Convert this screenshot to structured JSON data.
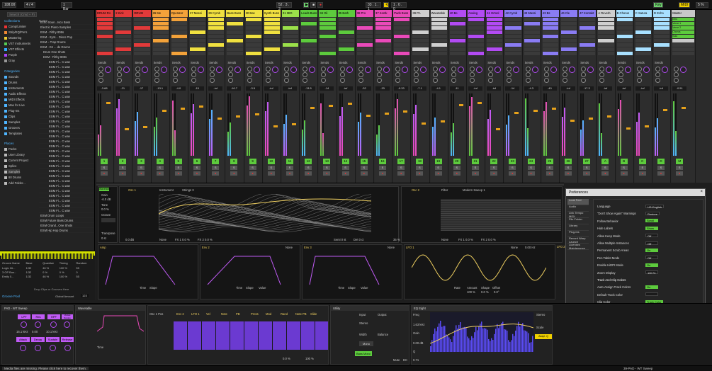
{
  "colors": {
    "accent": "#f0d000",
    "green": "#5dcb3d",
    "purple": "#b24bf3",
    "blue": "#4fb5ff"
  },
  "transport": {
    "tempo": "108.00",
    "sig": "4 / 4",
    "bar": "1 Bar",
    "pos": "52 . 3 . 3",
    "loop_start": "33 . 1 . 1",
    "loop_len": "1 . 0 . 0",
    "key": "Key",
    "midi": "MIDI",
    "cpu": "5 %"
  },
  "browser": {
    "search_placeholder": "Search (Cmd + F)",
    "collections_title": "Collections",
    "collections": [
      {
        "label": "Comp/Limiter",
        "color": "#e33"
      },
      {
        "label": "Strip/EQ/Pre's",
        "color": "#e83"
      },
      {
        "label": "Mastering",
        "color": "#ec3"
      },
      {
        "label": "VST Instruments",
        "color": "#5c5"
      },
      {
        "label": "VST Effects",
        "color": "#3af"
      },
      {
        "label": "Purple",
        "color": "#a4f"
      },
      {
        "label": "Gray",
        "color": "#999"
      }
    ],
    "categories_title": "Categories",
    "categories": [
      "Sounds",
      "Drums",
      "Instruments",
      "Audio Effects",
      "MIDI Effects",
      "Max for Live",
      "Plug-Ins",
      "Clips",
      "Samples",
      "Grooves",
      "Templates"
    ],
    "places_title": "Places",
    "places": [
      "Packs",
      "User Library",
      "Current Project",
      "Splice",
      "Samples",
      "80 Drums",
      "Add Folder..."
    ],
    "list_header": "Name",
    "list": [
      "Echo Soun...Isco Bass",
      "Electric Piano Samples",
      "ESM - Filthy 808s",
      "ESM - Synt... Disco Pop",
      "ESM – Trap Drums",
      "ESM - DJ ... de Drums",
      "Drum One Shots",
      "ESM - Filthy 808s",
      "ESM Fi... C.wav",
      "ESM Fi... C.wav",
      "ESM Fi... C.wav",
      "ESM Fi... C.wav",
      "ESM Fi... C.wav",
      "ESM Fi... C.wav",
      "ESM Fi... C.wav",
      "ESM Fi... C.wav",
      "ESM Fi... C.wav",
      "ESM Fi... C.wav",
      "ESM Fi... C.wav",
      "ESM Fi... C.wav",
      "ESM Fi... C.wav",
      "ESM Fi... C.wav",
      "ESM Fi... C.wav",
      "ESM Fi... C.wav",
      "ESM Fi... C.wav",
      "ESM Fi... C.wav",
      "ESM Fi... C.wav",
      "ESM Fi... C.wav",
      "ESM Fi... C.wav",
      "ESM Fi... C.wav",
      "ESM Fi... C.wav",
      "ESM Fi... C.wav",
      "ESM Fi... C.wav",
      "ESM Fi... C.wav",
      "ESM Fi... C.wav",
      "ESM Fi... C.wav",
      "ESM Fi... C.wav",
      "ESM Fi... C.wav",
      "ESM Fi... C.wav",
      "ESM Drum Loops",
      "ESM Future Bass Drums",
      "ESM Grand...One Shots",
      "ESM Hip Hop Drums"
    ]
  },
  "groove": {
    "headers": [
      "Groove Name",
      "Base",
      "Quantize",
      "Timing",
      "Random"
    ],
    "rows": [
      [
        "Logic 16...",
        "1/32",
        "46 %",
        "100 %",
        "55"
      ],
      [
        "3 OP Bus...",
        "1/32",
        "0 %",
        "0 %",
        "0"
      ],
      [
        "Emily 0...",
        "1/32",
        "46 %",
        "100 %",
        "55"
      ]
    ],
    "hint": "Drop Clips or Grooves Here",
    "amount_label": "Global Amount",
    "amount": "123",
    "pool": "Groove Pool"
  },
  "tracks": [
    {
      "name": "DRUM RA",
      "color": "#e23a3a",
      "vol": "-3.68",
      "num": "1"
    },
    {
      "name": "2 Kick",
      "color": "#e23a3a",
      "vol": "-21",
      "num": "2"
    },
    {
      "name": "DRUM",
      "color": "#e23a3a",
      "vol": "-17",
      "num": "3"
    },
    {
      "name": "26 Me",
      "color": "#f3a23a",
      "vol": "-13.1",
      "num": "4"
    },
    {
      "name": "Operator",
      "color": "#f3a23a",
      "vol": "-4.0",
      "num": "5"
    },
    {
      "name": "27 Massi",
      "color": "#f0e040",
      "vol": "-15",
      "num": "6"
    },
    {
      "name": "29 Cymb",
      "color": "#f0e040",
      "vol": "-inf",
      "num": "7"
    },
    {
      "name": "Bass Buss",
      "color": "#f0e040",
      "vol": "-16.7",
      "num": "8"
    },
    {
      "name": "30 Bas",
      "color": "#f0e040",
      "vol": "-3.5",
      "num": "9"
    },
    {
      "name": "Synth Buss",
      "color": "#f0e040",
      "vol": "-inf",
      "num": "10"
    },
    {
      "name": "31 MID",
      "color": "#9be04a",
      "vol": "-inf",
      "num": "11"
    },
    {
      "name": "Leads Buss",
      "color": "#5dcb3d",
      "vol": "-13.5",
      "num": "12"
    },
    {
      "name": "34 Gli",
      "color": "#5dcb3d",
      "vol": "-14",
      "num": "13"
    },
    {
      "name": "35 Bath",
      "color": "#5dcb3d",
      "vol": "-inf",
      "num": "14"
    },
    {
      "name": "38 Pro",
      "color": "#e94ab9",
      "vol": "-32",
      "num": "15"
    },
    {
      "name": "37 Kontk",
      "color": "#e94ab9",
      "vol": "-33",
      "num": "16"
    },
    {
      "name": "Pads Buss",
      "color": "#e94ab9",
      "vol": "-9.33",
      "num": "17"
    },
    {
      "name": "39 PA",
      "color": "#cfcfcf",
      "vol": "-7.1",
      "num": "18"
    },
    {
      "name": "Wavetable",
      "color": "#cfcfcf",
      "vol": "-4.1",
      "num": "19"
    },
    {
      "name": "40 Be",
      "color": "#b24bf3",
      "vol": "-11",
      "num": "20"
    },
    {
      "name": "Analog",
      "color": "#b24bf3",
      "vol": "-inf",
      "num": "21"
    },
    {
      "name": "41 Grtool",
      "color": "#b24bf3",
      "vol": "-inf",
      "num": "22"
    },
    {
      "name": "42 Cymb",
      "color": "#8a7cf3",
      "vol": "-14",
      "num": "23"
    },
    {
      "name": "43 Massi",
      "color": "#8a7cf3",
      "vol": "-4.3",
      "num": "24"
    },
    {
      "name": "43 Bs",
      "color": "#8a7cf3",
      "vol": "-40",
      "num": "25"
    },
    {
      "name": "46 Cle",
      "color": "#8a7cf3",
      "vol": "-inf",
      "num": "26"
    },
    {
      "name": "47 Kontakt",
      "color": "#8a7cf3",
      "vol": "-17.3",
      "num": "27"
    },
    {
      "name": "A Reverb",
      "color": "#cfcfcf",
      "vol": "-inf",
      "num": "A"
    },
    {
      "name": "B Chorus",
      "color": "#a8e0ff",
      "vol": "-inf",
      "num": "B"
    },
    {
      "name": "C Satura",
      "color": "#a8e0ff",
      "vol": "-inf",
      "num": "C"
    },
    {
      "name": "D Echo",
      "color": "#a8e0ff",
      "vol": "-inf",
      "num": "D"
    },
    {
      "name": "Master",
      "color": "#c8c8c8",
      "vol": "-0.51",
      "num": "M"
    }
  ],
  "master_clips": [
    "Intro",
    "Verse 1",
    "Verse 2",
    "Chorus",
    "Solo"
  ],
  "mixer": {
    "sends_label": "Sends"
  },
  "wavetable": {
    "title": "Wavetable",
    "osc1": "Osc 1",
    "osc2": "Osc 2",
    "inst": "Instrument",
    "inst_val": "Strings 3",
    "filter": "Filter",
    "filter_val": "Modern Sweep 1",
    "gain": "Gain",
    "gain_val": "-6.0 dB",
    "tone": "Tone",
    "tone_val": "0.0 %",
    "octave": "Octave",
    "transpose": "Transpose",
    "transpose_val": "0 st",
    "none": "None",
    "fx1": "FX 1 0.0 %",
    "fx2": "FX 2 0.0 %",
    "semi": "Semi 0 st",
    "det": "Det 0 ct",
    "pct": "35 %",
    "db": "0.0 dB",
    "amp": "Amp",
    "env2": "Env 2",
    "env3": "Env 3",
    "lfo1": "LFO 1",
    "lfo2": "LFO 2",
    "time": "Time",
    "slope": "Slope",
    "value": "Value",
    "rate": "Rate",
    "amount": "Amount",
    "shape": "Shape",
    "offset": "Offset",
    "rate_val": "0.00 Hz",
    "amount_val": "100 %",
    "shape_val": "0.0 %",
    "offset_val": "0.0°"
  },
  "preferences": {
    "title": "Preferences",
    "tabs": [
      "Look Feel",
      "Audio",
      "Link Tempo MIDI",
      "File Folder",
      "Library",
      "Plug-Ins",
      "Record Warp Launch",
      "Licenses Maintenance"
    ],
    "rows": [
      {
        "label": "Language",
        "value": "US-English",
        "style": "pd"
      },
      {
        "label": "\"Don't Show Again\" Warnings",
        "value": "Restore",
        "style": "pd"
      },
      {
        "label": "Follow Behavior",
        "value": "Scroll",
        "style": "pg"
      },
      {
        "label": "Hide Labels",
        "value": "Show",
        "style": "pg"
      },
      {
        "label": "Allow Keep Mode",
        "value": "Off",
        "style": "pd"
      },
      {
        "label": "Allow Multiple Instances",
        "value": "Off",
        "style": "pd"
      },
      {
        "label": "Permanent Scrub Areas",
        "value": "On",
        "style": "pg"
      },
      {
        "label": "Pen Tablet Mode",
        "value": "Off",
        "style": "pd"
      },
      {
        "label": "Enable HiDPI Mode",
        "value": "On",
        "style": "pg"
      },
      {
        "label": "Zoom Display",
        "value": "100 %",
        "style": "pd"
      },
      {
        "label": "Track And Clip Colors",
        "value": "",
        "style": "none"
      },
      {
        "label": "Auto-Assign Track Colors",
        "value": "On",
        "style": "pg"
      },
      {
        "label": "Default Track Color",
        "value": "",
        "style": "pd"
      },
      {
        "label": "Clip Color",
        "value": "Track Color",
        "style": "pg"
      },
      {
        "label": "Reduced Automatic Colors",
        "value": "Off",
        "style": "pd"
      },
      {
        "label": "Customization",
        "value": "",
        "style": "none"
      },
      {
        "label": "Theme",
        "value": "Purple Beige 2.0",
        "style": "pd"
      },
      {
        "label": "Brightness",
        "value": "85 %",
        "style": "pd"
      },
      {
        "label": "Color Intensity",
        "value": "0 %",
        "style": "pd"
      },
      {
        "label": "Color Hue",
        "value": "0 °",
        "style": "pd"
      },
      {
        "label": "Grid Line Intensity",
        "value": "88 %",
        "style": "pd"
      }
    ]
  },
  "bottom": {
    "pad_title": "PAD - WT Sweep",
    "lpf": "LPF",
    "res": "Res",
    "hpf": "HPF",
    "voices": "Voices Detune",
    "lpf_val": "16.1 kHz",
    "res_val": "0.00",
    "hpf_val": "10.1 kHz",
    "attack": "Attack",
    "decay": "Decay",
    "sustain": "Sustain",
    "release": "Release",
    "wt_title": "Wavetable",
    "osc": "Osc 1 Pos",
    "env": "Env 2",
    "lfo": "LFO 1",
    "vel": "Vel",
    "note": "Note",
    "pb": "PB",
    "press": "Press",
    "mod": "Mod",
    "rand": "Rand",
    "notepb": "Note PB",
    "slide": "Slide",
    "utility_title": "Utility",
    "input": "Input",
    "output": "Output",
    "gain": "Gain",
    "mono": "Mono",
    "stereo": "Stereo",
    "width": "Width",
    "balance": "Balance",
    "bass_mono": "Bass Mono",
    "eq_title": "EQ Eight",
    "freq": "Freq",
    "q": "Q",
    "adapt": "Adapt. Q",
    "scale": "Scale",
    "stereo_l": "Stereo",
    "freq_val": "1.63 kHz",
    "gain_val": "0.00 dB",
    "q_val": "0.71",
    "time": "Time",
    "time_val": "0.0 %",
    "amount": "Amount",
    "amount_val": "100 %",
    "mute": "Mute",
    "dc": "DC",
    "ext": "Ext"
  },
  "status": {
    "message": "Media files are missing. Please click here to recover them.",
    "track": "39-PAD - WT Sweep"
  }
}
